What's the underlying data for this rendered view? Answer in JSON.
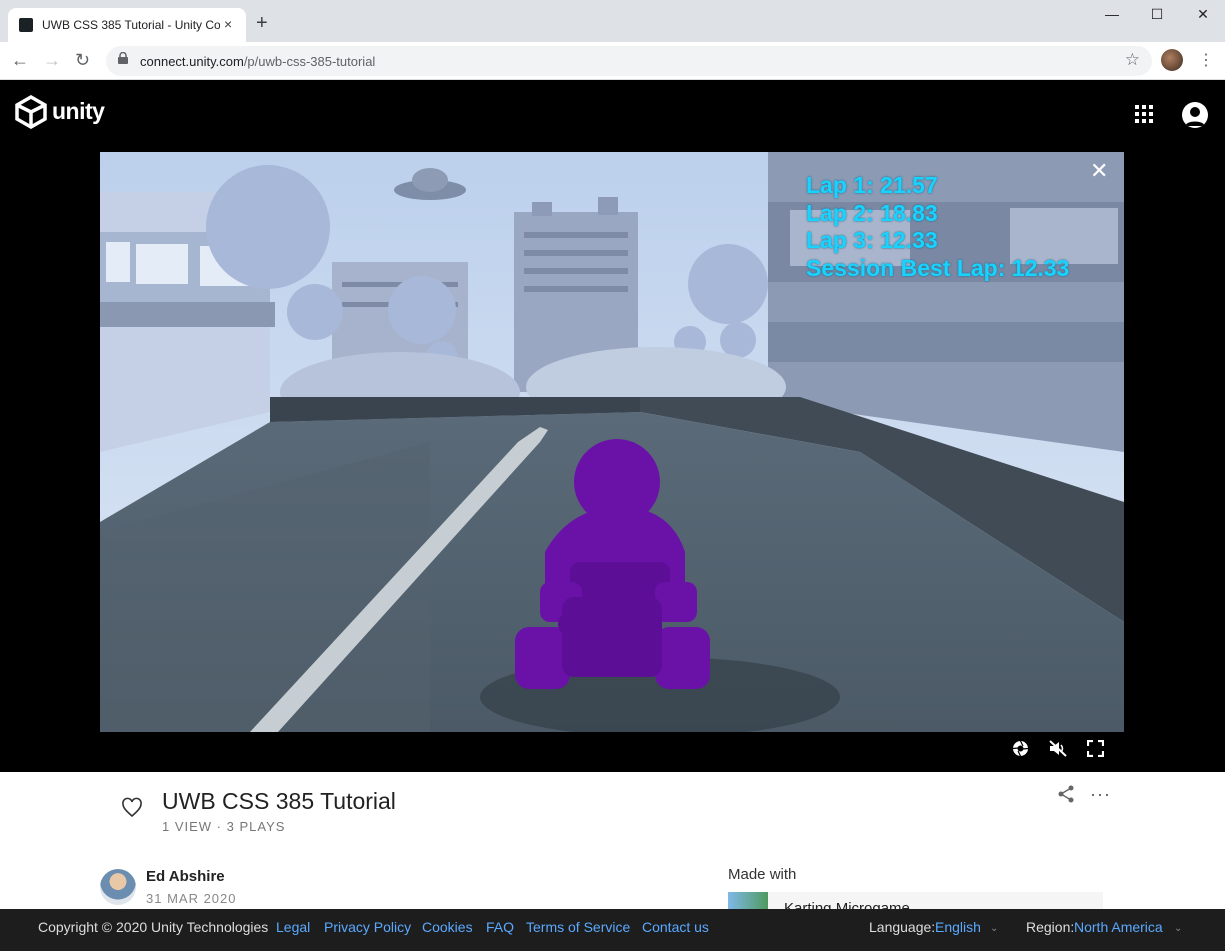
{
  "browser": {
    "tab_title": "UWB CSS 385 Tutorial - Unity Co",
    "tab_close": "×",
    "new_tab": "+",
    "url_host": "connect.unity.com",
    "url_path": "/p/uwb-css-385-tutorial",
    "window_controls": {
      "minimize": "—",
      "maximize": "☐",
      "close": "✕"
    }
  },
  "header": {
    "logo_text": "unity"
  },
  "game": {
    "hud_lines": [
      "Lap 1: 21.57",
      "Lap 2: 18.83",
      "Lap 3: 12.33",
      "Session Best Lap: 12.33"
    ],
    "close": "✕",
    "kart_color": "#6a12a8",
    "hud_color": "#19d3ff"
  },
  "project": {
    "title": "UWB CSS 385 Tutorial",
    "stats": "1 VIEW · 3 PLAYS",
    "author": "Ed Abshire",
    "date": "31 MAR 2020",
    "made_with_label": "Made with",
    "made_with_name": "Karting Microgame",
    "more": "···"
  },
  "footer": {
    "copyright": "Copyright © 2020 Unity Technologies",
    "links": [
      "Legal",
      "Privacy Policy",
      "Cookies",
      "FAQ",
      "Terms of Service",
      "Contact us"
    ],
    "language_label": "Language:",
    "language_value": "English",
    "region_label": "Region:",
    "region_value": "North America"
  }
}
